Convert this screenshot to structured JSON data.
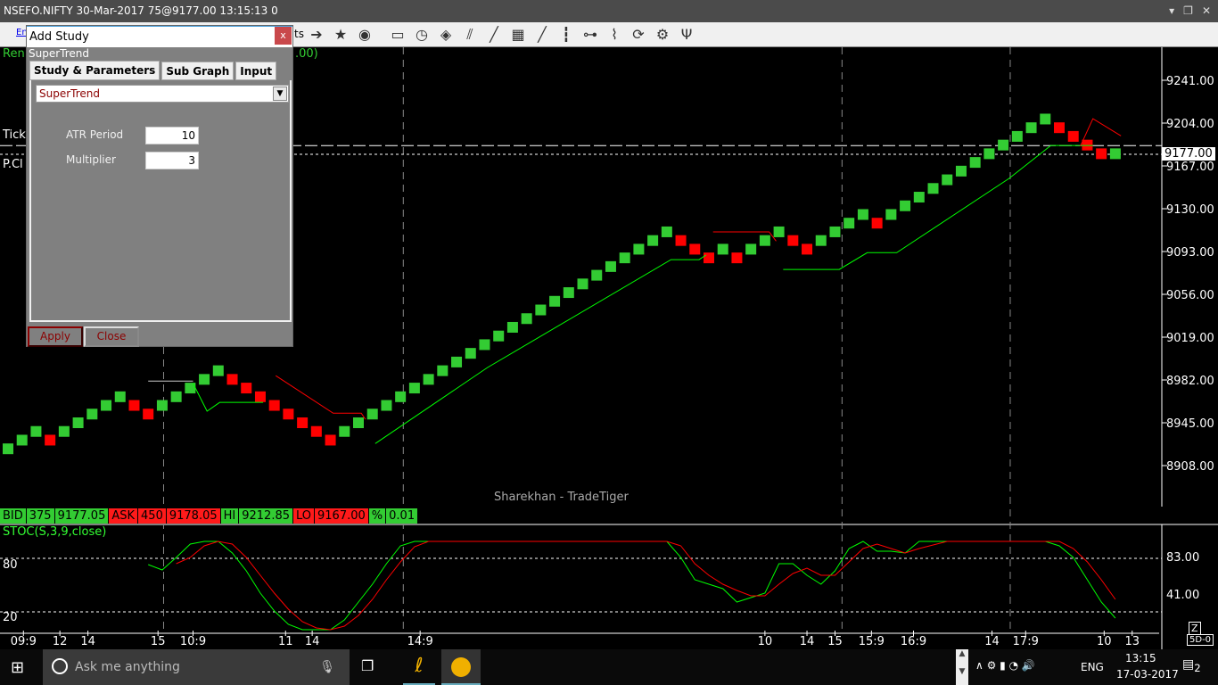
{
  "window": {
    "title": "NSEFO.NIFTY 30-Mar-2017 75@9177.00 13:15:13 0"
  },
  "toolbar": {
    "partial_left": "Enl",
    "partial_right": "ts",
    "icons": [
      "arrow-right-icon",
      "star-icon",
      "eye-calendar-icon",
      "new-window-icon",
      "stopwatch-icon",
      "shield-icon",
      "parallel-lines-icon",
      "line-icon",
      "fibonacci-icon",
      "trend-line-icon",
      "vertical-line-icon",
      "horizontal-link-icon",
      "zigzag-icon",
      "refresh-icon",
      "gear-remove-icon",
      "fork-icon"
    ]
  },
  "chart": {
    "header_partial": "Ren",
    "header_partial_right": ".00)",
    "tick_label": "Tick",
    "pclose_label": "P.Cl",
    "watermark": "Sharekhan - TradeTiger",
    "current_price": "9177.00",
    "colors": {
      "up": "#33cc33",
      "down": "#ff0000",
      "background": "#000000"
    }
  },
  "chart_data": [
    {
      "type": "renko",
      "y_ticks": [
        "9241.00",
        "9204.00",
        "9167.00",
        "9130.00",
        "9093.00",
        "9056.00",
        "9019.00",
        "8982.00",
        "8945.00",
        "8908.00"
      ],
      "ylim": [
        8880,
        9280
      ],
      "bricks": [
        [
          8922.5,
          "up"
        ],
        [
          8930,
          "up"
        ],
        [
          8937.5,
          "up"
        ],
        [
          8930,
          "down"
        ],
        [
          8937.5,
          "up"
        ],
        [
          8945,
          "up"
        ],
        [
          8952.5,
          "up"
        ],
        [
          8960,
          "up"
        ],
        [
          8967.5,
          "up"
        ],
        [
          8960,
          "down"
        ],
        [
          8952.5,
          "down"
        ],
        [
          8960,
          "up"
        ],
        [
          8967.5,
          "up"
        ],
        [
          8975,
          "up"
        ],
        [
          8982.5,
          "up"
        ],
        [
          8990,
          "up"
        ],
        [
          8982.5,
          "down"
        ],
        [
          8975,
          "down"
        ],
        [
          8967.5,
          "down"
        ],
        [
          8960,
          "down"
        ],
        [
          8952.5,
          "down"
        ],
        [
          8945,
          "down"
        ],
        [
          8937.5,
          "down"
        ],
        [
          8930,
          "down"
        ],
        [
          8937.5,
          "up"
        ],
        [
          8945,
          "up"
        ],
        [
          8952.5,
          "up"
        ],
        [
          8960,
          "up"
        ],
        [
          8967.5,
          "up"
        ],
        [
          8975,
          "up"
        ],
        [
          8982.5,
          "up"
        ],
        [
          8990,
          "up"
        ],
        [
          8997.5,
          "up"
        ],
        [
          9005,
          "up"
        ],
        [
          9012.5,
          "up"
        ],
        [
          9020,
          "up"
        ],
        [
          9027.5,
          "up"
        ],
        [
          9035,
          "up"
        ],
        [
          9042.5,
          "up"
        ],
        [
          9050,
          "up"
        ],
        [
          9057.5,
          "up"
        ],
        [
          9065,
          "up"
        ],
        [
          9072.5,
          "up"
        ],
        [
          9080,
          "up"
        ],
        [
          9087.5,
          "up"
        ],
        [
          9095,
          "up"
        ],
        [
          9102.5,
          "up"
        ],
        [
          9110,
          "up"
        ],
        [
          9102.5,
          "down"
        ],
        [
          9095,
          "down"
        ],
        [
          9087.5,
          "down"
        ],
        [
          9095,
          "up"
        ],
        [
          9087.5,
          "down"
        ],
        [
          9095,
          "up"
        ],
        [
          9102.5,
          "up"
        ],
        [
          9110,
          "up"
        ],
        [
          9102.5,
          "down"
        ],
        [
          9095,
          "down"
        ],
        [
          9102.5,
          "up"
        ],
        [
          9110,
          "up"
        ],
        [
          9117.5,
          "up"
        ],
        [
          9125,
          "up"
        ],
        [
          9117.5,
          "down"
        ],
        [
          9125,
          "up"
        ],
        [
          9132.5,
          "up"
        ],
        [
          9140,
          "up"
        ],
        [
          9147.5,
          "up"
        ],
        [
          9155,
          "up"
        ],
        [
          9162.5,
          "up"
        ],
        [
          9170,
          "up"
        ],
        [
          9177.5,
          "up"
        ],
        [
          9185,
          "up"
        ],
        [
          9192.5,
          "up"
        ],
        [
          9200,
          "up"
        ],
        [
          9207.5,
          "up"
        ],
        [
          9200,
          "down"
        ],
        [
          9192.5,
          "down"
        ],
        [
          9185,
          "down"
        ],
        [
          9177.5,
          "down"
        ],
        [
          9177.5,
          "up"
        ]
      ],
      "supertrend": [
        {
          "trend": "neutral",
          "points": [
            [
              10,
              8981
            ],
            [
              13.2,
              8981
            ]
          ]
        },
        {
          "trend": "up",
          "points": [
            [
              13.2,
              8979
            ],
            [
              14.2,
              8955
            ],
            [
              15.1,
              8962.6
            ],
            [
              18.2,
              8962.6
            ]
          ]
        },
        {
          "trend": "down",
          "points": [
            [
              19.1,
              8985.7
            ],
            [
              23.2,
              8953.3
            ],
            [
              25.2,
              8953.3
            ],
            [
              25.5,
              8948
            ]
          ]
        },
        {
          "trend": "up",
          "points": [
            [
              26.2,
              8927
            ],
            [
              34.2,
              8992.7
            ],
            [
              47.3,
              9086
            ],
            [
              49.3,
              9086
            ],
            [
              49.8,
              9090
            ]
          ]
        },
        {
          "trend": "down",
          "points": [
            [
              50.3,
              9110
            ],
            [
              54.3,
              9110
            ],
            [
              54.8,
              9102
            ]
          ]
        },
        {
          "trend": "up",
          "points": [
            [
              55.3,
              9077.5
            ],
            [
              59.3,
              9077.5
            ],
            [
              61.3,
              9092
            ],
            [
              63.4,
              9092
            ],
            [
              71.4,
              9156
            ],
            [
              74.4,
              9184.6
            ],
            [
              77.4,
              9184.6
            ]
          ]
        },
        {
          "trend": "down",
          "points": [
            [
              76.5,
              9184
            ],
            [
              77.4,
              9207.8
            ],
            [
              79.4,
              9193
            ]
          ]
        }
      ],
      "reference_lines": [
        9184.5,
        9177
      ]
    },
    {
      "type": "line",
      "title": "STOC(S,3,9,close)",
      "left_ticks": [
        "80",
        "20"
      ],
      "right_ticks": [
        "83.00",
        "41.00"
      ],
      "ylim": [
        0,
        100
      ],
      "series": [
        {
          "color": "#00ff00",
          "points": [
            [
              10,
              74
            ],
            [
              11,
              68
            ],
            [
              12,
              82
            ],
            [
              13,
              97
            ],
            [
              14,
              100
            ],
            [
              15,
              100
            ],
            [
              16,
              87
            ],
            [
              17,
              67
            ],
            [
              18,
              42
            ],
            [
              19,
              22
            ],
            [
              20,
              7
            ],
            [
              21,
              1
            ],
            [
              23,
              1
            ],
            [
              24,
              12
            ],
            [
              25,
              32
            ],
            [
              26,
              52
            ],
            [
              27,
              75
            ],
            [
              28,
              95
            ],
            [
              29,
              100
            ],
            [
              47,
              100
            ],
            [
              48,
              82
            ],
            [
              49,
              57
            ],
            [
              50,
              52
            ],
            [
              51,
              47
            ],
            [
              52,
              32
            ],
            [
              53,
              37
            ],
            [
              54,
              42
            ],
            [
              55,
              75
            ],
            [
              56,
              75
            ],
            [
              57,
              62
            ],
            [
              58,
              52
            ],
            [
              59,
              67
            ],
            [
              60,
              92
            ],
            [
              61,
              100
            ],
            [
              62,
              89
            ],
            [
              63,
              89
            ],
            [
              64,
              87
            ],
            [
              65,
              100
            ],
            [
              74,
              100
            ],
            [
              75,
              95
            ],
            [
              76,
              82
            ],
            [
              77,
              57
            ],
            [
              78,
              32
            ],
            [
              79,
              14
            ]
          ]
        },
        {
          "color": "#ff0000",
          "points": [
            [
              12,
              75
            ],
            [
              13,
              82
            ],
            [
              14,
              95
            ],
            [
              15,
              100
            ],
            [
              16,
              97
            ],
            [
              17,
              82
            ],
            [
              18,
              62
            ],
            [
              19,
              42
            ],
            [
              20,
              24
            ],
            [
              21,
              10
            ],
            [
              22,
              3
            ],
            [
              23,
              1
            ],
            [
              24,
              5
            ],
            [
              25,
              17
            ],
            [
              26,
              35
            ],
            [
              27,
              57
            ],
            [
              28,
              77
            ],
            [
              29,
              94
            ],
            [
              30,
              100
            ],
            [
              47,
              100
            ],
            [
              48,
              95
            ],
            [
              49,
              75
            ],
            [
              50,
              62
            ],
            [
              51,
              52
            ],
            [
              52,
              45
            ],
            [
              53,
              39
            ],
            [
              54,
              39
            ],
            [
              55,
              52
            ],
            [
              56,
              64
            ],
            [
              57,
              70
            ],
            [
              58,
              62
            ],
            [
              59,
              62
            ],
            [
              60,
              77
            ],
            [
              61,
              92
            ],
            [
              62,
              97
            ],
            [
              63,
              92
            ],
            [
              64,
              87
            ],
            [
              65,
              92
            ],
            [
              67,
              100
            ],
            [
              75,
              100
            ],
            [
              76,
              92
            ],
            [
              77,
              77
            ],
            [
              78,
              57
            ],
            [
              79,
              35
            ]
          ]
        }
      ]
    }
  ],
  "time_axis": {
    "labels": [
      [
        "09:9",
        1.1
      ],
      [
        "12",
        3.7
      ],
      [
        "14",
        5.7
      ],
      [
        "15",
        10.7
      ],
      [
        "10:9",
        13.2
      ],
      [
        "11",
        19.8
      ],
      [
        "14",
        21.7
      ],
      [
        "14:9",
        29.4
      ],
      [
        "10",
        54
      ],
      [
        "14",
        57
      ],
      [
        "15",
        59
      ],
      [
        "15:9",
        61.6
      ],
      [
        "16:9",
        64.6
      ],
      [
        "14",
        70.2
      ],
      [
        "17:9",
        72.6
      ],
      [
        "10",
        78.2
      ],
      [
        "13",
        80.2
      ]
    ],
    "session_lines": [
      11.1,
      28.2,
      59.5,
      71.5
    ],
    "corner_z": "Z",
    "corner_label": "5D-0"
  },
  "quotes": [
    {
      "t": "BID",
      "c": "g"
    },
    {
      "t": "375",
      "c": "g"
    },
    {
      "t": "9177.05",
      "c": "g"
    },
    {
      "t": "ASK",
      "c": "r"
    },
    {
      "t": "450",
      "c": "r"
    },
    {
      "t": "9178.05",
      "c": "r"
    },
    {
      "t": "HI",
      "c": "g"
    },
    {
      "t": "9212.85",
      "c": "g"
    },
    {
      "t": "LO",
      "c": "r"
    },
    {
      "t": "9167.00",
      "c": "r"
    },
    {
      "t": "%",
      "c": "g"
    },
    {
      "t": "0.01",
      "c": "g"
    }
  ],
  "dialog": {
    "title": "Add Study",
    "close": "x",
    "subtitle": "SuperTrend",
    "tabs": [
      "Study & Parameters",
      "Sub Graph",
      "Input"
    ],
    "study": "SuperTrend",
    "params": [
      {
        "label": "ATR Period",
        "value": "10"
      },
      {
        "label": "Multiplier",
        "value": "3"
      }
    ],
    "apply": "Apply",
    "close_btn": "Close"
  },
  "taskbar": {
    "search_placeholder": "Ask me anything",
    "language": "ENG",
    "time": "13:15",
    "date": "17-03-2017",
    "notifications": "2"
  }
}
